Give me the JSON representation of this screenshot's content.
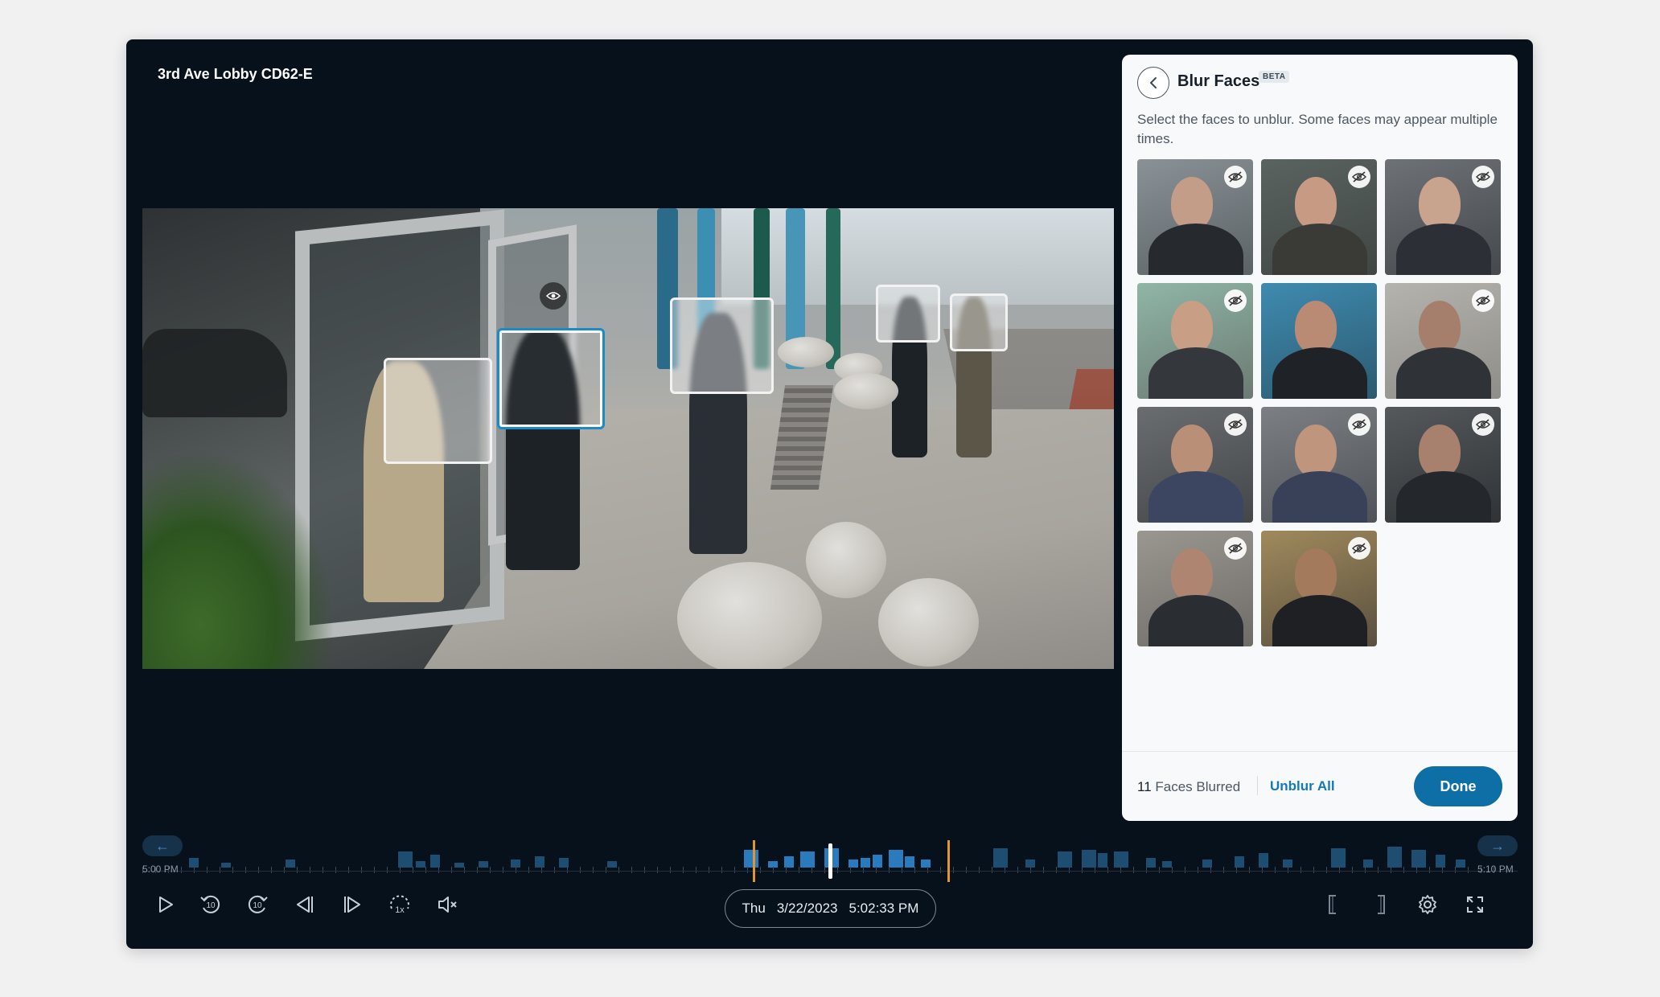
{
  "camera": {
    "title": "3rd Ave Lobby CD62-E"
  },
  "panel": {
    "title": "Blur Faces",
    "badge": "BETA",
    "description": "Select the faces to unblur. Some faces may appear multiple times.",
    "faces": [
      {
        "label": "face-1",
        "blurred": true
      },
      {
        "label": "face-2",
        "blurred": true
      },
      {
        "label": "face-3",
        "blurred": true
      },
      {
        "label": "face-4",
        "blurred": true
      },
      {
        "label": "face-5",
        "blurred": false
      },
      {
        "label": "face-6",
        "blurred": true
      },
      {
        "label": "face-7",
        "blurred": true
      },
      {
        "label": "face-8",
        "blurred": true
      },
      {
        "label": "face-9",
        "blurred": true
      },
      {
        "label": "face-10",
        "blurred": true
      },
      {
        "label": "face-11",
        "blurred": true
      }
    ],
    "footer": {
      "count_number": "11",
      "count_label": "Faces Blurred",
      "unblur_all": "Unblur All",
      "done": "Done"
    }
  },
  "timeline": {
    "start_label": "5:00 PM",
    "end_label": "5:10 PM"
  },
  "controls": {
    "day": "Thu",
    "date": "3/22/2023",
    "time": "5:02:33 PM",
    "rewind_seconds": "10",
    "forward_seconds": "10",
    "speed": "1x"
  },
  "colors": {
    "accent": "#1479b8",
    "done_button": "#0d6fa6",
    "window_bg": "#07111c",
    "clip_marker": "#e3952f"
  }
}
